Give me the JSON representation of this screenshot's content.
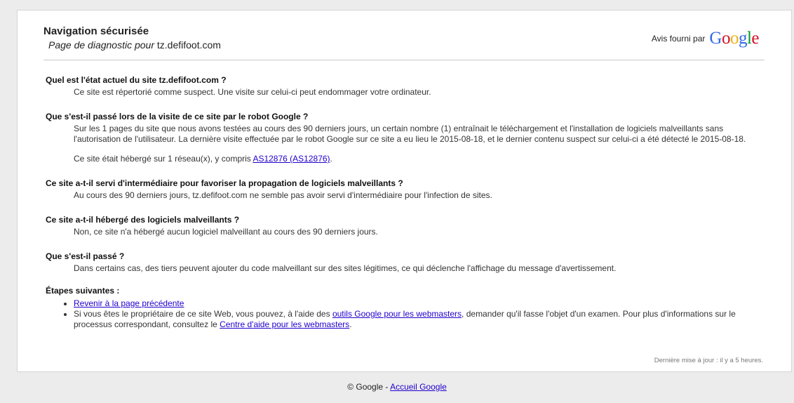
{
  "header": {
    "title": "Navigation sécurisée",
    "subtitle_prefix": "Page de diagnostic pour",
    "subtitle_site": "tz.defifoot.com",
    "provider_text": "Avis fourni par",
    "logo_letters": [
      {
        "ch": "G",
        "color": "#3369e8"
      },
      {
        "ch": "o",
        "color": "#d50f25"
      },
      {
        "ch": "o",
        "color": "#eeb211"
      },
      {
        "ch": "g",
        "color": "#3369e8"
      },
      {
        "ch": "l",
        "color": "#009925"
      },
      {
        "ch": "e",
        "color": "#d50f25"
      }
    ]
  },
  "sections": {
    "s1": {
      "question": "Quel est l'état actuel du site tz.defifoot.com ?",
      "answer": "Ce site est répertorié comme suspect. Une visite sur celui-ci peut endommager votre ordinateur."
    },
    "s2": {
      "question": "Que s'est-il passé lors de la visite de ce site par le robot Google ?",
      "answer": "Sur les 1 pages du site que nous avons testées au cours des 90 derniers jours, un certain nombre (1) entraînait le téléchargement et l'installation de logiciels malveillants sans l'autorisation de l'utilisateur. La dernière visite effectuée par le robot Google sur ce site a eu lieu le 2015-08-18, et le dernier contenu suspect sur celui-ci a été détecté le 2015-08-18.",
      "hosted_prefix": "Ce site était hébergé sur 1 réseau(x), y compris",
      "hosted_link": "AS12876 (AS12876)",
      "hosted_suffix": "."
    },
    "s3": {
      "question": "Ce site a-t-il servi d'intermédiaire pour favoriser la propagation de logiciels malveillants ?",
      "answer": "Au cours des 90 derniers jours, tz.defifoot.com ne semble pas avoir servi d'intermédiaire pour l'infection de sites."
    },
    "s4": {
      "question": "Ce site a-t-il hébergé des logiciels malveillants ?",
      "answer": "Non, ce site n'a hébergé aucun logiciel malveillant au cours des 90 derniers jours."
    },
    "s5": {
      "question": "Que s'est-il passé ?",
      "answer": "Dans certains cas, des tiers peuvent ajouter du code malveillant sur des sites légitimes, ce qui déclenche l'affichage du message d'avertissement."
    }
  },
  "steps": {
    "heading": "Étapes suivantes :",
    "back_link": "Revenir à la page précédente",
    "owner_prefix": "Si vous êtes le propriétaire de ce site Web, vous pouvez, à l'aide des",
    "webmaster_tools_link": "outils Google pour les webmasters",
    "owner_middle": ", demander qu'il fasse l'objet d'un examen. Pour plus d'informations sur le processus correspondant, consultez le",
    "help_center_link": "Centre d'aide pour les webmasters",
    "owner_suffix": "."
  },
  "last_updated": "Dernière mise à jour : il y a 5 heures.",
  "footer": {
    "copyright": "© Google - ",
    "home_link": "Accueil Google"
  }
}
